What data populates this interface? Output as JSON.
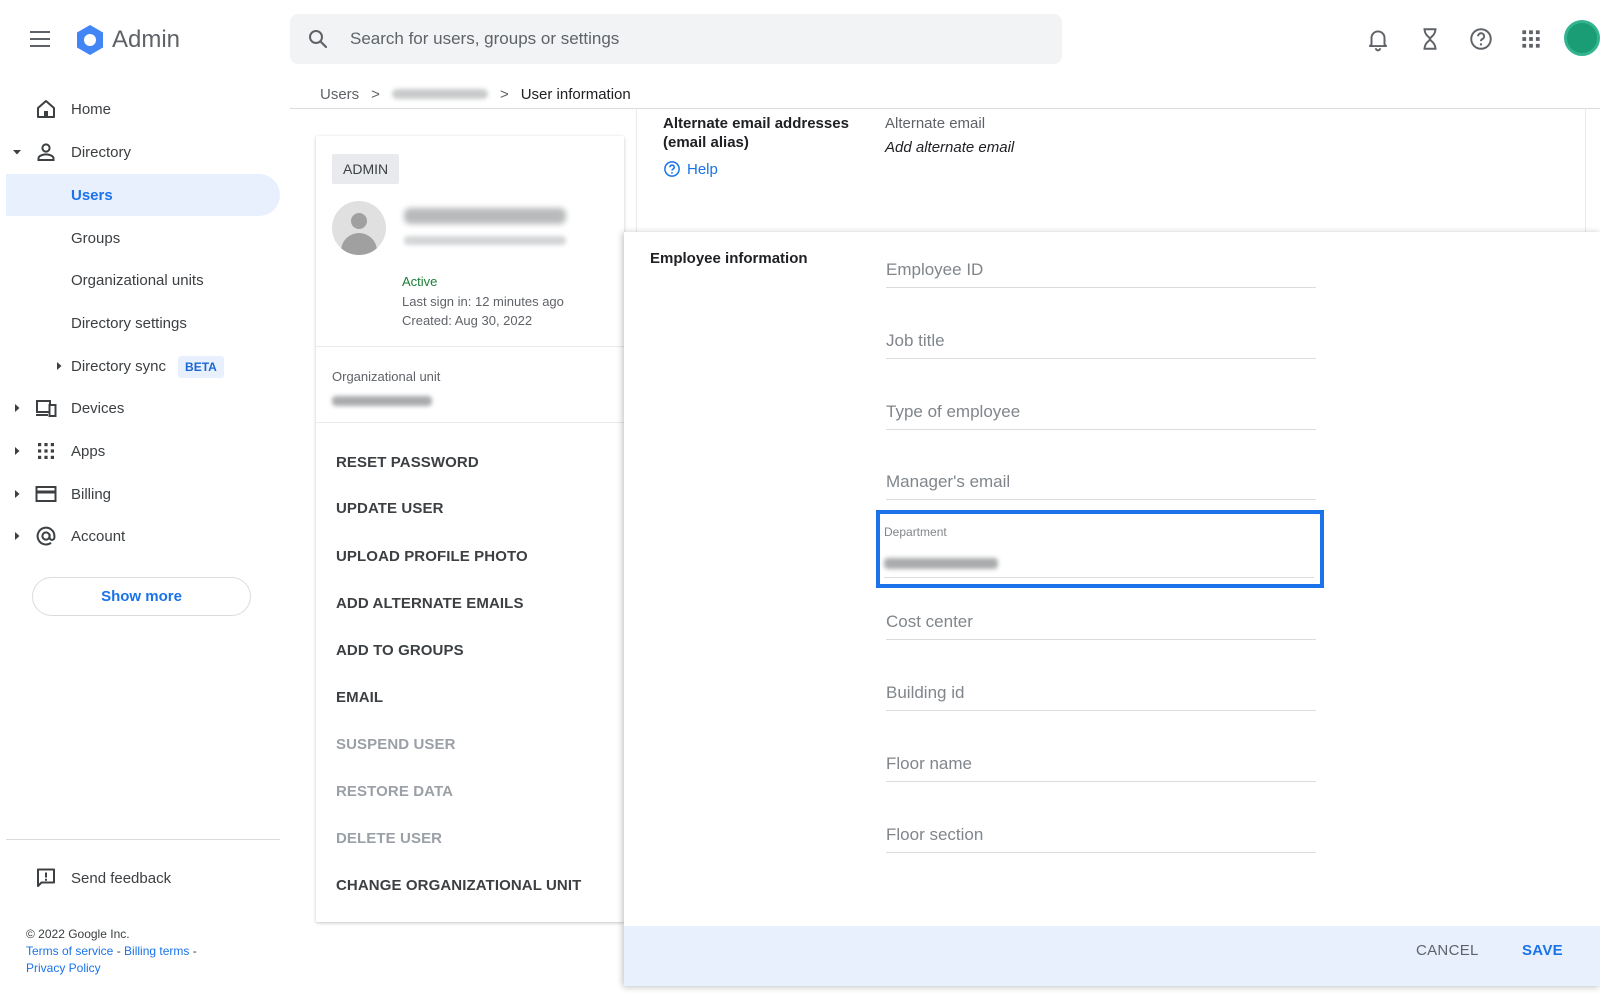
{
  "app": {
    "title": "Admin"
  },
  "search": {
    "placeholder": "Search for users, groups or settings"
  },
  "header_icons": [
    "bell-icon",
    "hourglass-icon",
    "help-icon",
    "apps-grid-icon",
    "account-avatar"
  ],
  "sidebar": {
    "items": [
      {
        "label": "Home",
        "icon": "home-icon"
      },
      {
        "label": "Directory",
        "icon": "person-icon",
        "expanded": true
      },
      {
        "label": "Users",
        "active": true
      },
      {
        "label": "Groups"
      },
      {
        "label": "Organizational units"
      },
      {
        "label": "Directory settings"
      },
      {
        "label": "Directory sync",
        "badge": "BETA"
      },
      {
        "label": "Devices",
        "icon": "devices-icon"
      },
      {
        "label": "Apps",
        "icon": "apps-icon"
      },
      {
        "label": "Billing",
        "icon": "credit-card-icon"
      },
      {
        "label": "Account",
        "icon": "at-sign-icon"
      }
    ],
    "show_more": "Show more",
    "feedback": "Send feedback",
    "copyright": "© 2022 Google Inc.",
    "links": {
      "terms": "Terms of service",
      "billing": "Billing terms",
      "privacy": "Privacy Policy",
      "sep": "-"
    }
  },
  "breadcrumb": {
    "root": "Users",
    "current": "User information",
    "sep": ">"
  },
  "user_card": {
    "role_chip": "ADMIN",
    "status": "Active",
    "last_sign_in": "Last sign in: 12 minutes ago",
    "created": "Created: Aug 30, 2022",
    "ou_label": "Organizational unit",
    "actions": [
      {
        "label": "RESET PASSWORD",
        "enabled": true
      },
      {
        "label": "UPDATE USER",
        "enabled": true
      },
      {
        "label": "UPLOAD PROFILE PHOTO",
        "enabled": true
      },
      {
        "label": "ADD ALTERNATE EMAILS",
        "enabled": true
      },
      {
        "label": "ADD TO GROUPS",
        "enabled": true
      },
      {
        "label": "EMAIL",
        "enabled": true
      },
      {
        "label": "SUSPEND USER",
        "enabled": false
      },
      {
        "label": "RESTORE DATA",
        "enabled": false
      },
      {
        "label": "DELETE USER",
        "enabled": false
      },
      {
        "label": "CHANGE ORGANIZATIONAL UNIT",
        "enabled": true
      }
    ]
  },
  "alias": {
    "title": "Alternate email addresses (email alias)",
    "help": "Help",
    "label": "Alternate email",
    "add": "Add alternate email"
  },
  "employee": {
    "title": "Employee information",
    "fields": {
      "employee_id": "Employee ID",
      "job_title": "Job title",
      "type": "Type of employee",
      "manager": "Manager's email",
      "department": "Department",
      "cost_center": "Cost center",
      "building": "Building id",
      "floor_name": "Floor name",
      "floor_section": "Floor section"
    },
    "cancel": "CANCEL",
    "save": "SAVE"
  },
  "colors": {
    "accent": "#1a73e8",
    "active_bg": "#e8f0fe",
    "status_active": "#188038",
    "highlight": "#1a73e8"
  }
}
